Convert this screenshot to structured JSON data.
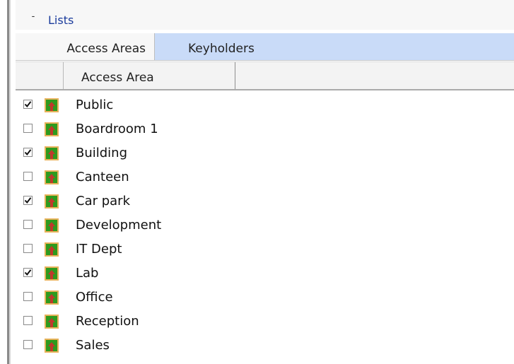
{
  "section": {
    "toggle": "-",
    "title": "Lists"
  },
  "tabs": [
    {
      "label": "Access Areas"
    },
    {
      "label": "Keyholders"
    }
  ],
  "grid": {
    "column_header": "Access Area"
  },
  "icons": {
    "area": "access-area-icon",
    "check": "checkmark-icon"
  },
  "colors": {
    "selected_tab": "#c9dbf8",
    "title_link": "#1a3b9c",
    "icon_green": "#2e9a1e",
    "icon_arrow": "#c0392b"
  },
  "items": [
    {
      "label": "Public",
      "checked": true
    },
    {
      "label": "Boardroom 1",
      "checked": false
    },
    {
      "label": "Building",
      "checked": true
    },
    {
      "label": "Canteen",
      "checked": false
    },
    {
      "label": "Car park",
      "checked": true
    },
    {
      "label": "Development",
      "checked": false
    },
    {
      "label": "IT Dept",
      "checked": false
    },
    {
      "label": "Lab",
      "checked": true
    },
    {
      "label": "Office",
      "checked": false
    },
    {
      "label": "Reception",
      "checked": false
    },
    {
      "label": "Sales",
      "checked": false
    }
  ]
}
